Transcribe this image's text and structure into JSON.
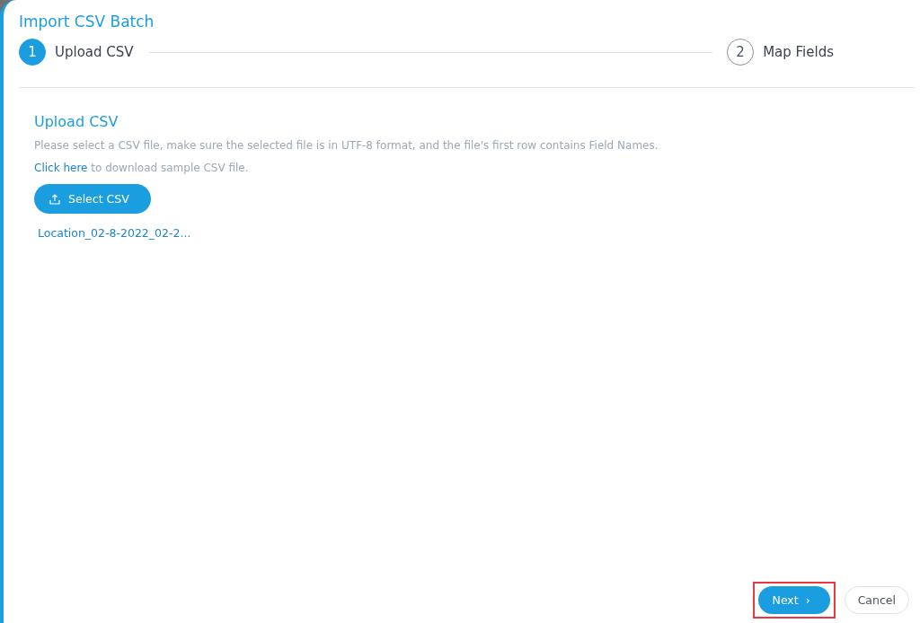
{
  "dialog": {
    "title": "Import CSV Batch"
  },
  "steps": [
    {
      "number": "1",
      "label": "Upload CSV",
      "selected": true
    },
    {
      "number": "2",
      "label": "Map Fields",
      "selected": false
    }
  ],
  "section": {
    "heading": "Upload CSV",
    "instructions": "Please select a CSV file, make sure the selected file is in UTF-8 format, and the file's first row contains Field Names.",
    "download_link": "Click here",
    "download_text": " to download sample CSV file.",
    "select_button": "Select CSV",
    "file_name": "Location_02-8-2022_02-2..."
  },
  "footer": {
    "buttons": [
      {
        "label": "Next",
        "kind": "primary",
        "icon": "›",
        "highlighted": true
      },
      {
        "label": "Cancel",
        "kind": "secondary",
        "highlighted": false
      }
    ]
  }
}
